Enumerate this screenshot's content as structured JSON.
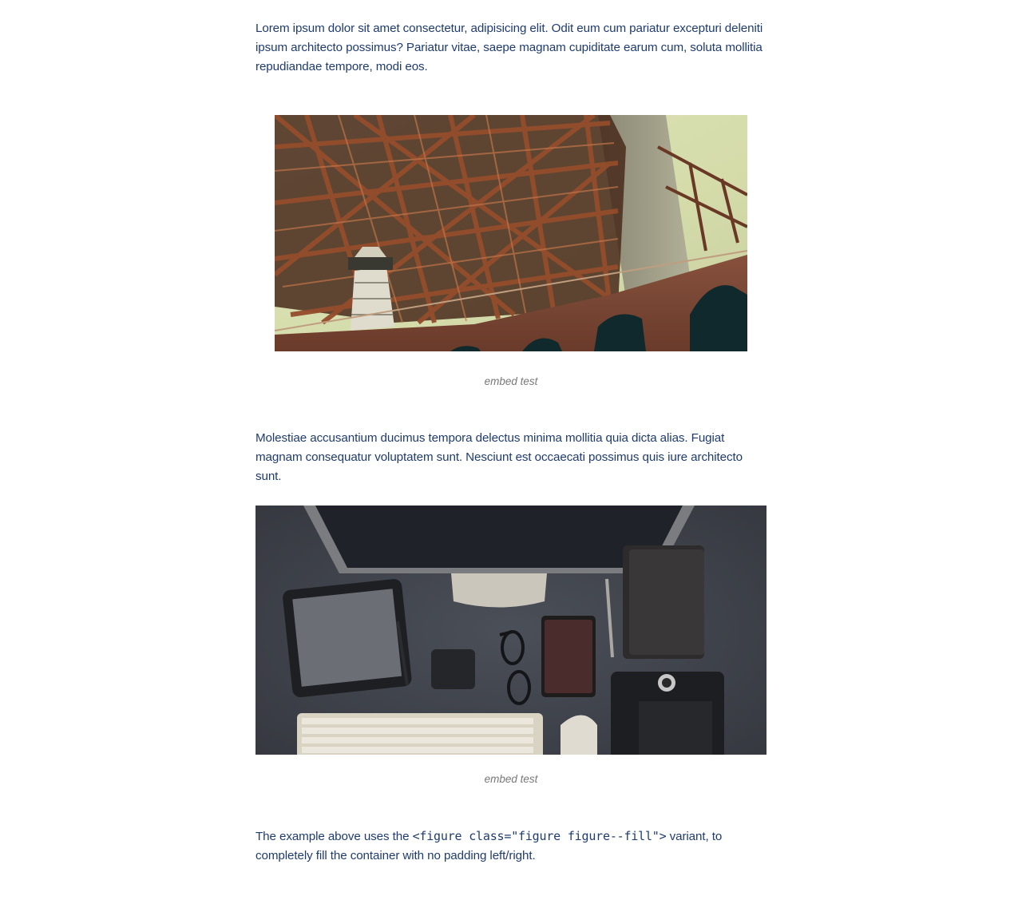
{
  "article": {
    "paragraph_1": "Lorem ipsum dolor sit amet consectetur, adipisicing elit. Odit eum cum pariatur excepturi deleniti ipsum architecto possimus? Pariatur vitae, saepe magnam cupiditate earum cum, soluta mollitia repudiandae tempore, modi eos.",
    "figure_1": {
      "caption": "embed test"
    },
    "paragraph_2": "Molestiae accusantium ducimus tempora delectus minima mollitia quia dicta alias. Fugiat magnam consequatur voluptatem sunt. Nesciunt est occaecati possimus quis iure architecto sunt.",
    "figure_2": {
      "caption": "embed test"
    },
    "paragraph_3": {
      "before_code": "The example above uses the ",
      "code": "<figure class=\"figure figure--fill\">",
      "after_code": " variant, to completely fill the container with no padding left/right."
    }
  },
  "colors": {
    "text": "#1f3c6e",
    "caption": "#777777",
    "background": "#ffffff"
  }
}
